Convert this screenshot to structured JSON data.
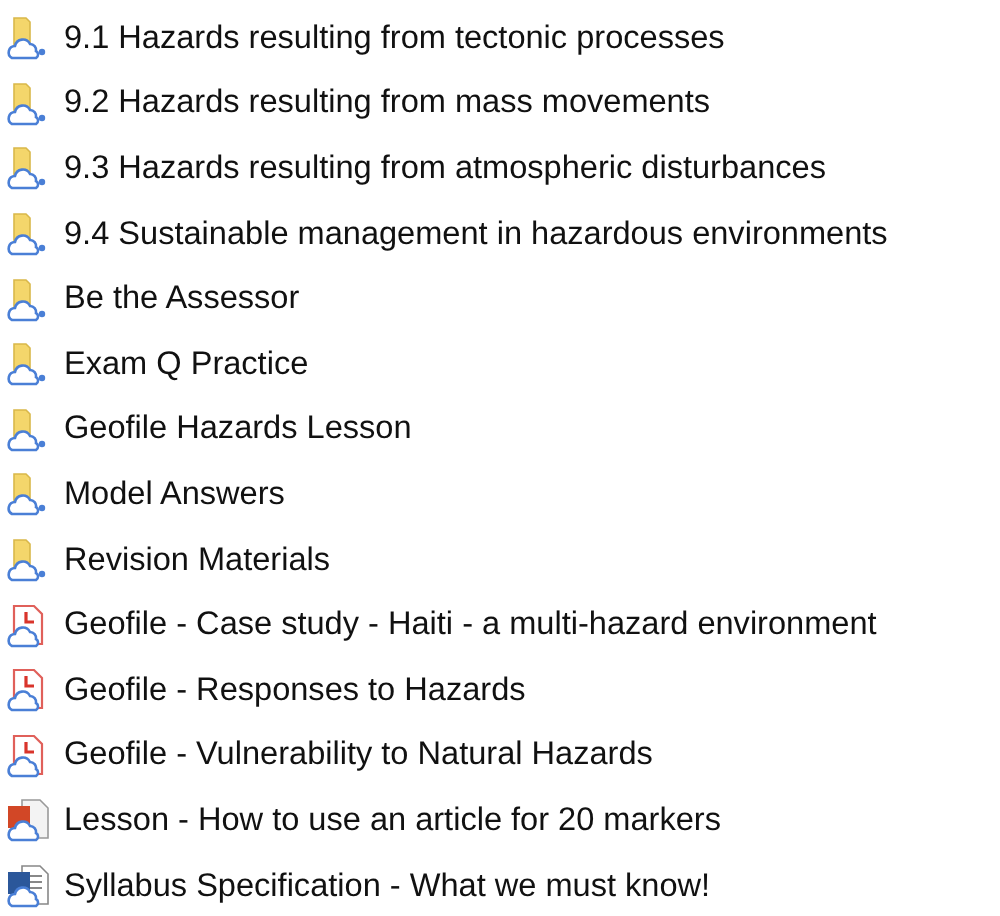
{
  "files": [
    {
      "name": "9.1 Hazards resulting from tectonic processes",
      "kind": "folder"
    },
    {
      "name": "9.2 Hazards resulting from mass movements",
      "kind": "folder"
    },
    {
      "name": "9.3 Hazards resulting from atmospheric disturbances",
      "kind": "folder"
    },
    {
      "name": "9.4 Sustainable management in hazardous environments",
      "kind": "folder"
    },
    {
      "name": "Be the Assessor",
      "kind": "folder"
    },
    {
      "name": "Exam Q Practice",
      "kind": "folder"
    },
    {
      "name": "Geofile Hazards Lesson",
      "kind": "folder"
    },
    {
      "name": "Model Answers",
      "kind": "folder"
    },
    {
      "name": "Revision Materials",
      "kind": "folder"
    },
    {
      "name": "Geofile - Case study - Haiti - a multi-hazard environment",
      "kind": "pdf"
    },
    {
      "name": "Geofile - Responses to Hazards",
      "kind": "pdf"
    },
    {
      "name": "Geofile - Vulnerability to Natural Hazards",
      "kind": "pdf"
    },
    {
      "name": "Lesson - How to use an article for 20 markers",
      "kind": "slides"
    },
    {
      "name": "Syllabus Specification - What we must know!",
      "kind": "document"
    }
  ]
}
